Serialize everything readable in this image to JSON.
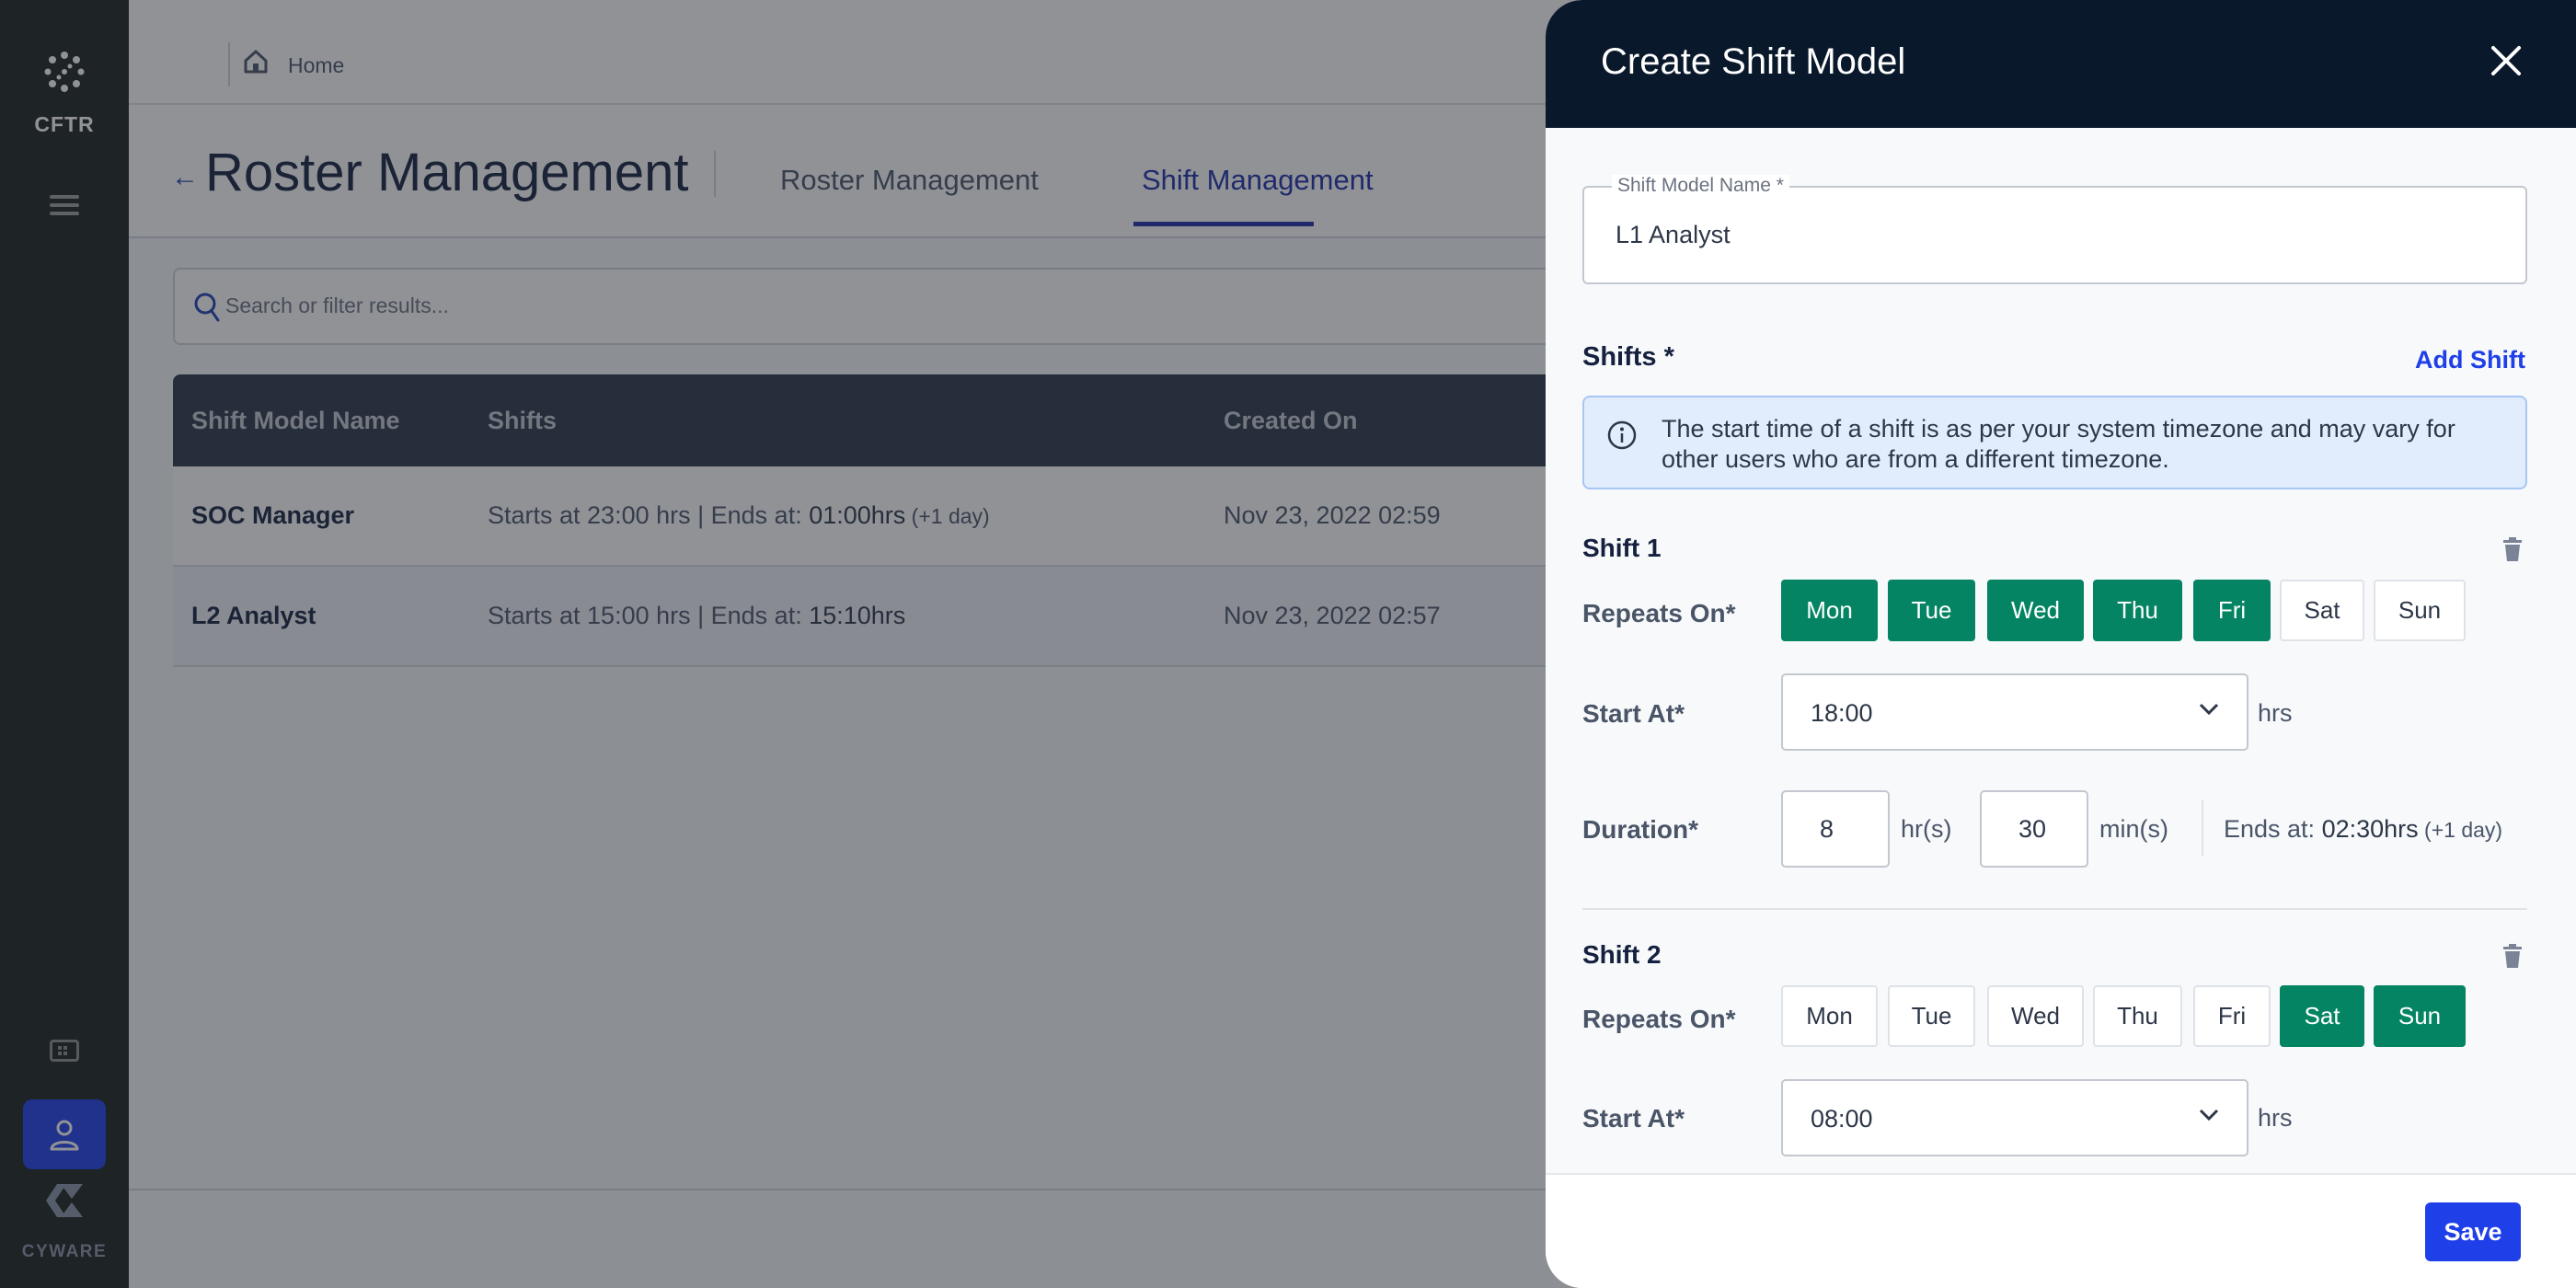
{
  "sidebar": {
    "brand": "CFTR",
    "footer_brand": "CYWARE",
    "icons": [
      "cftr-logo-icon",
      "menu-icon",
      "card-icon",
      "user-settings-icon",
      "cyware-logo-icon"
    ],
    "active_color": "#1f3fe8"
  },
  "topbar": {
    "breadcrumb_home": "Home"
  },
  "page": {
    "title": "Roster Management",
    "tabs": [
      {
        "label": "Roster Management",
        "active": false
      },
      {
        "label": "Shift Management",
        "active": true
      }
    ],
    "search_placeholder": "Search or filter results..."
  },
  "table": {
    "columns": [
      "Shift Model Name",
      "Shifts",
      "Created On"
    ],
    "rows": [
      {
        "name": "SOC Manager",
        "shift_prefix": "Starts at 23:00 hrs | Ends at: ",
        "shift_end": "01:00hrs",
        "shift_suffix": " (+1 day)",
        "created": "Nov 23, 2022 02:59"
      },
      {
        "name": "L2 Analyst",
        "shift_prefix": "Starts at 15:00 hrs | Ends at: ",
        "shift_end": "15:10hrs",
        "shift_suffix": "",
        "created": "Nov 23, 2022 02:57"
      }
    ]
  },
  "panel": {
    "title": "Create Shift Model",
    "name_label": "Shift Model Name *",
    "name_value": "L1 Analyst",
    "shifts_label": "Shifts *",
    "add_shift": "Add Shift",
    "info": "The start time of a shift is as per your system timezone and may vary for other users who are from a different timezone.",
    "labels": {
      "repeats": "Repeats On*",
      "start": "Start At*",
      "duration": "Duration*",
      "hrs": "hrs",
      "hours_unit": "hr(s)",
      "mins_unit": "min(s)"
    },
    "shifts": [
      {
        "title": "Shift 1",
        "days": [
          {
            "label": "Mon",
            "on": true
          },
          {
            "label": "Tue",
            "on": true
          },
          {
            "label": "Wed",
            "on": true
          },
          {
            "label": "Thu",
            "on": true
          },
          {
            "label": "Fri",
            "on": true
          },
          {
            "label": "Sat",
            "on": false
          },
          {
            "label": "Sun",
            "on": false
          }
        ],
        "start": "18:00",
        "duration_hours": "8",
        "duration_minutes": "30",
        "ends_prefix": "Ends at: ",
        "ends_time": "02:30hrs",
        "ends_suffix": " (+1 day)"
      },
      {
        "title": "Shift 2",
        "days": [
          {
            "label": "Mon",
            "on": false
          },
          {
            "label": "Tue",
            "on": false
          },
          {
            "label": "Wed",
            "on": false
          },
          {
            "label": "Thu",
            "on": false
          },
          {
            "label": "Fri",
            "on": false
          },
          {
            "label": "Sat",
            "on": true
          },
          {
            "label": "Sun",
            "on": true
          }
        ],
        "start": "08:00"
      }
    ],
    "save": "Save",
    "colors": {
      "selected_day": "#058464",
      "primary": "#1f3fe8",
      "header": "#0a182b"
    }
  }
}
